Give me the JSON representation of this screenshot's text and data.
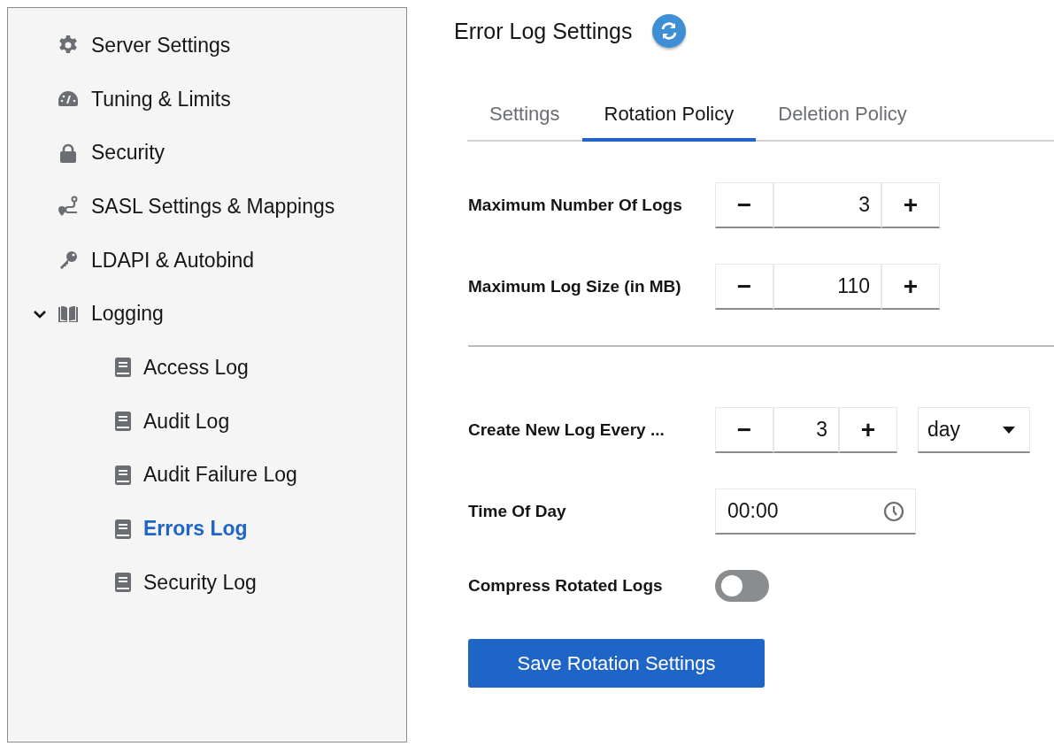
{
  "sidebar": {
    "items": [
      {
        "label": "Server Settings",
        "kind": "gear"
      },
      {
        "label": "Tuning & Limits",
        "kind": "gauge"
      },
      {
        "label": "Security",
        "kind": "lock"
      },
      {
        "label": "SASL Settings & Mappings",
        "kind": "route"
      },
      {
        "label": "LDAPI & Autobind",
        "kind": "key"
      },
      {
        "label": "Logging",
        "kind": "book-open",
        "expanded": true,
        "children": [
          {
            "label": "Access Log",
            "selected": false
          },
          {
            "label": "Audit Log",
            "selected": false
          },
          {
            "label": "Audit Failure Log",
            "selected": false
          },
          {
            "label": "Errors Log",
            "selected": true
          },
          {
            "label": "Security Log",
            "selected": false
          }
        ]
      }
    ]
  },
  "page": {
    "title": "Error Log Settings"
  },
  "tabs": [
    {
      "label": "Settings",
      "selected": false
    },
    {
      "label": "Rotation Policy",
      "selected": true
    },
    {
      "label": "Deletion Policy",
      "selected": false
    }
  ],
  "fields": [
    {
      "kind": "number",
      "label": "Maximum Number Of Logs",
      "value": "3",
      "minus": "−",
      "plus": "+"
    },
    {
      "kind": "number",
      "label": "Maximum Log Size (in MB)",
      "value": "110",
      "minus": "−",
      "plus": "+"
    },
    {
      "kind": "divider"
    },
    {
      "kind": "number_unit",
      "label": "Create New Log Every ...",
      "value": "3",
      "minus": "−",
      "plus": "+",
      "unit": "day"
    },
    {
      "kind": "time",
      "label": "Time Of Day",
      "value": "00:00"
    },
    {
      "kind": "toggle",
      "label": "Compress Rotated Logs",
      "on": false
    }
  ],
  "save_button": "Save Rotation Settings"
}
